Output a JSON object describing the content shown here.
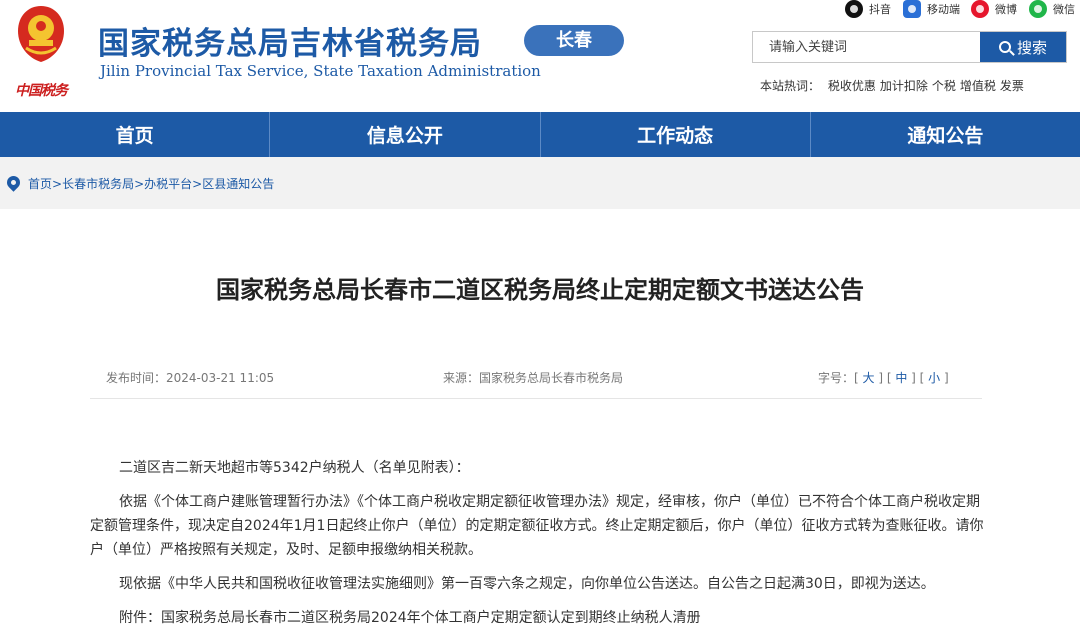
{
  "header": {
    "emblem_caption": "中国税务",
    "title": "国家税务总局吉林省税务局",
    "subtitle": "Jilin Provincial Tax Service, State Taxation Administration",
    "city": "长春"
  },
  "social": [
    {
      "label": "抖音",
      "icon": "douyin-icon"
    },
    {
      "label": "移动端",
      "icon": "mobile-icon"
    },
    {
      "label": "微博",
      "icon": "weibo-icon"
    },
    {
      "label": "微信",
      "icon": "wechat-icon"
    }
  ],
  "search": {
    "placeholder": "请输入关键词",
    "button_label": "搜索",
    "hot_label": "本站热词：",
    "hot_words": [
      "税收优惠",
      "加计扣除",
      "个税",
      "增值税",
      "发票"
    ]
  },
  "nav": [
    "首页",
    "信息公开",
    "工作动态",
    "通知公告"
  ],
  "breadcrumb": [
    "首页",
    "长春市税务局",
    "办税平台",
    "区县通知公告"
  ],
  "article": {
    "title": "国家税务总局长春市二道区税务局终止定期定额文书送达公告",
    "date": "发布时间：2024-03-21 11:05",
    "source": "来源：国家税务总局长春市税务局",
    "font_label": "字号：",
    "font_sizes": [
      "大",
      "中",
      "小"
    ],
    "paragraphs": [
      "二道区吉二新天地超市等5342户纳税人（名单见附表）：",
      "依据《个体工商户建账管理暂行办法》《个体工商户税收定期定额征收管理办法》规定，经审核，你户（单位）已不符合个体工商户税收定期定额管理条件，现决定自2024年1月1日起终止你户（单位）的定期定额征收方式。终止定期定额后，你户（单位）征收方式转为查账征收。请你户（单位）严格按照有关规定，及时、足额申报缴纳相关税款。",
      "现依据《中华人民共和国税收征收管理法实施细则》第一百零六条之规定，向你单位公告送达。自公告之日起满30日，即视为送达。",
      "附件：国家税务总局长春市二道区税务局2024年个体工商户定期定额认定到期终止纳税人清册"
    ]
  },
  "colors": {
    "brand_blue": "#1d5aa6",
    "pill_blue": "#3a72bb",
    "emblem_red": "#cc1f1f"
  }
}
